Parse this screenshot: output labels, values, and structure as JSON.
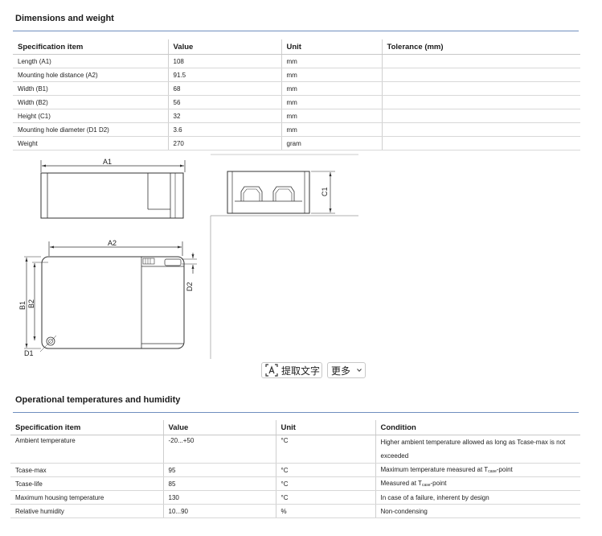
{
  "sections": {
    "dimensions": {
      "title": "Dimensions and weight",
      "headers": [
        "Specification item",
        "Value",
        "Unit",
        "Tolerance (mm)"
      ],
      "rows": [
        [
          "Length (A1)",
          "108",
          "mm",
          ""
        ],
        [
          "Mounting hole distance (A2)",
          "91.5",
          "mm",
          ""
        ],
        [
          "Width (B1)",
          "68",
          "mm",
          ""
        ],
        [
          "Width (B2)",
          "56",
          "mm",
          ""
        ],
        [
          "Height (C1)",
          "32",
          "mm",
          ""
        ],
        [
          "Mounting hole diameter (D1 D2)",
          "3.6",
          "mm",
          ""
        ],
        [
          "Weight",
          "270",
          "gram",
          ""
        ]
      ]
    },
    "temperatures": {
      "title": "Operational temperatures and humidity",
      "headers": [
        "Specification item",
        "Value",
        "Unit",
        "Condition"
      ],
      "rows": [
        [
          "Ambient temperature",
          "-20...+50",
          "°C",
          "Higher ambient temperature allowed as long as Tcase-max is not",
          "exceeded"
        ],
        [
          "Tcase-max",
          "95",
          "°C",
          "Maximum temperature measured at T",
          "case",
          "-point"
        ],
        [
          "Tcase-life",
          "85",
          "°C",
          "Measured at T",
          "case",
          "-point"
        ],
        [
          "Maximum housing temperature",
          "130",
          "°C",
          "In case of a failure, inherent by design"
        ],
        [
          "Relative humidity",
          "10...90",
          "%",
          "Non-condensing"
        ]
      ]
    }
  },
  "drawing_labels": {
    "a1": "A1",
    "a2": "A2",
    "b1": "B1",
    "b2": "B2",
    "c1": "C1",
    "d1": "D1",
    "d2": "D2"
  },
  "toolbar": {
    "extract_text_label": "提取文字",
    "more_label": "更多",
    "extract_icon": "text-extract-icon",
    "more_icon": "chevron-down-icon"
  }
}
